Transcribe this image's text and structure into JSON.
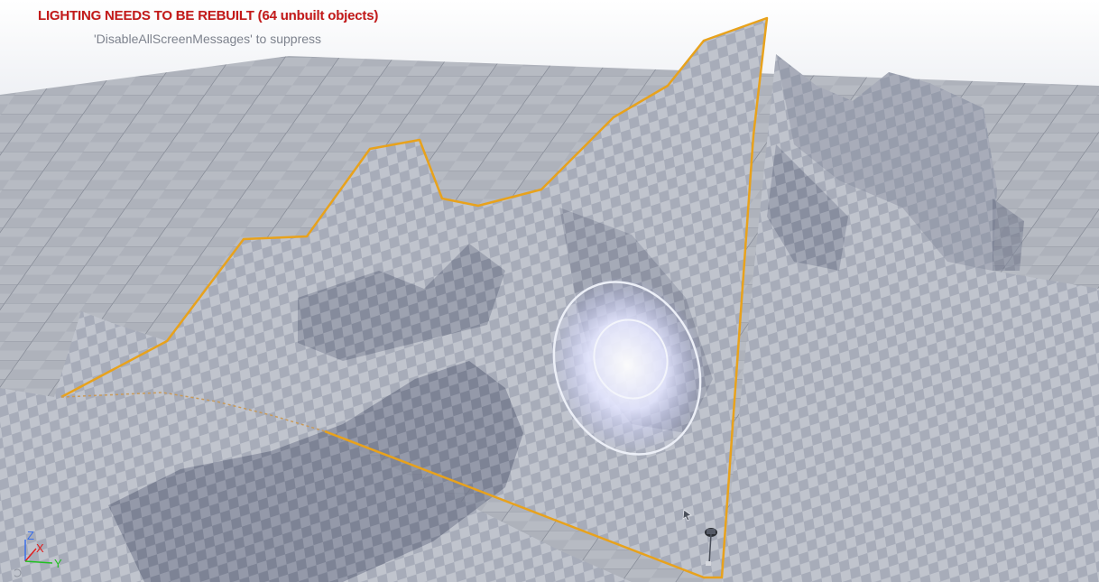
{
  "viewport": {
    "lighting_warning": "LIGHTING NEEDS TO BE REBUILT (64 unbuilt objects)",
    "suppress_hint": "'DisableAllScreenMessages' to suppress"
  },
  "axis_gizmo": {
    "z_label": "Z",
    "x_label": "X",
    "y_label": "Y",
    "x_color": "#e02020",
    "y_color": "#20c020",
    "z_color": "#3a6ee8"
  },
  "colors": {
    "selection_outline": "#e8a21c",
    "brush_ring": "#eceff7",
    "warning_text": "#c41a1a"
  },
  "icons": {
    "cursor": "pointer-cursor-icon",
    "component_marker": "actor-component-icon"
  }
}
